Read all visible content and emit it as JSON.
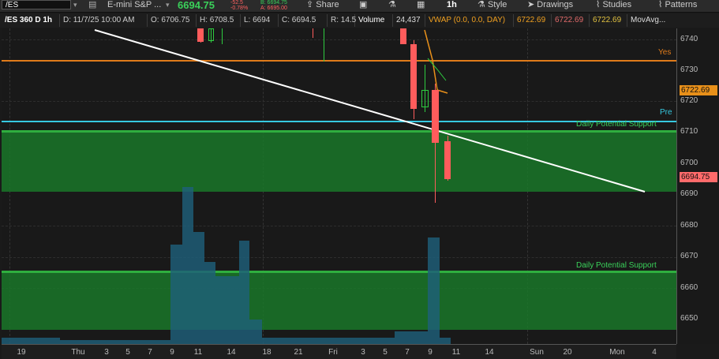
{
  "toolbar": {
    "symbol": "/ES",
    "instrument_name": "E-mini S&P ...",
    "last_price": "6694.75",
    "change_small_top": "-52.5",
    "change_pct": "-0.78%",
    "bid": "B: 6694.75",
    "ask": "A: 6695.00",
    "share_label": "Share",
    "interval_label": "1h",
    "style_label": "Style",
    "drawings_label": "Drawings",
    "studies_label": "Studies",
    "patterns_label": "Patterns"
  },
  "infobar": {
    "title": "/ES 360 D 1h",
    "date": "D: 11/7/25 10:00 AM",
    "open": "O: 6706.75",
    "high": "H: 6708.5",
    "low": "L: 6694",
    "close": "C: 6694.5",
    "range": "R: 14.5",
    "volume_label": "Volume",
    "volume_value": "24,437",
    "vwap_label": "VWAP (0.0, 0.0, DAY)",
    "vwap_1": "6722.69",
    "vwap_2": "6722.69",
    "vwap_3": "6722.69",
    "movavg_label": "MovAvg..."
  },
  "price_axis": {
    "ticks": [
      "6740",
      "6730",
      "6720",
      "6710",
      "6700",
      "6690",
      "6680",
      "6670",
      "6660",
      "6650"
    ],
    "vwap_badge": "6722.69",
    "last_badge": "6694.75"
  },
  "time_axis": {
    "labels": [
      "19",
      "Thu",
      "3",
      "5",
      "7",
      "9",
      "11",
      "14",
      "18",
      "21",
      "Fri",
      "3",
      "5",
      "7",
      "9",
      "11",
      "14",
      "Sun",
      "20",
      "Mon",
      "4"
    ]
  },
  "levels": {
    "yes_label": "Yes",
    "pre_label": "Pre",
    "support_upper_label": "Daily Potential Support",
    "support_lower_label": "Daily Potential Support"
  },
  "colors": {
    "up": "#2ecc40",
    "down": "#ff5c5c",
    "yes_line": "#e07b1a",
    "pre_line": "#36c8e0",
    "support_zone": "#1a7a2a",
    "volume": "#1f5f7a",
    "trendline": "#ffffff",
    "vwap": "#e8901a"
  }
}
